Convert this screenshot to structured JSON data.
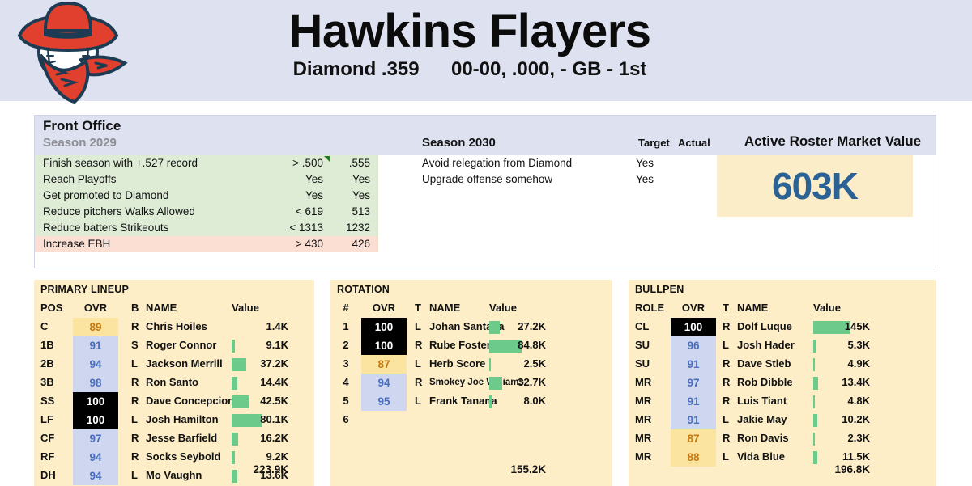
{
  "header": {
    "logo_icon": "cowboy-baseball-logo",
    "team_name": "Hawkins Flayers",
    "league": "Diamond .359",
    "record": "00-00, .000, - GB - 1st"
  },
  "front_office": {
    "title": "Front Office",
    "season_prev_label": "Season 2029",
    "season_cur_label": "Season 2030",
    "target_header": "Target",
    "actual_header": "Actual",
    "market_value_header": "Active Roster Market Value",
    "market_value": "603K",
    "prev_goals": [
      {
        "label": "Finish season with +.527 record",
        "target": "> .500",
        "actual": ".555",
        "status": "good",
        "marker": true
      },
      {
        "label": "Reach Playoffs",
        "target": "Yes",
        "actual": "Yes",
        "status": "good",
        "marker": false
      },
      {
        "label": "Get promoted to Diamond",
        "target": "Yes",
        "actual": "Yes",
        "status": "good",
        "marker": false
      },
      {
        "label": "Reduce pitchers Walks Allowed",
        "target": "< 619",
        "actual": "513",
        "status": "good",
        "marker": false
      },
      {
        "label": "Reduce batters Strikeouts",
        "target": "< 1313",
        "actual": "1232",
        "status": "good",
        "marker": false
      },
      {
        "label": "Increase EBH",
        "target": "> 430",
        "actual": "426",
        "status": "bad",
        "marker": false
      }
    ],
    "cur_goals": [
      {
        "label": "Avoid relegation from Diamond",
        "target": "Yes",
        "actual": ""
      },
      {
        "label": "Upgrade offense somehow",
        "target": "Yes",
        "actual": ""
      }
    ]
  },
  "lineup": {
    "title": "PRIMARY LINEUP",
    "columns": {
      "pos": "POS",
      "ovr": "OVR",
      "hand": "B",
      "name": "NAME",
      "value": "Value"
    },
    "total": "223.9K",
    "rows": [
      {
        "pos": "C",
        "ovr": "89",
        "tier": "gold",
        "hand": "R",
        "name": "Chris Hoiles",
        "value": "1.4K",
        "bar": 0
      },
      {
        "pos": "1B",
        "ovr": "91",
        "tier": "blue",
        "hand": "S",
        "name": "Roger Connor",
        "value": "9.1K",
        "bar": 4
      },
      {
        "pos": "2B",
        "ovr": "94",
        "tier": "blue",
        "hand": "L",
        "name": "Jackson Merrill",
        "value": "37.2K",
        "bar": 18
      },
      {
        "pos": "3B",
        "ovr": "98",
        "tier": "blue",
        "hand": "R",
        "name": "Ron Santo",
        "value": "14.4K",
        "bar": 7
      },
      {
        "pos": "SS",
        "ovr": "100",
        "tier": "black",
        "hand": "R",
        "name": "Dave Concepcion",
        "value": "42.5K",
        "bar": 21
      },
      {
        "pos": "LF",
        "ovr": "100",
        "tier": "black",
        "hand": "L",
        "name": "Josh Hamilton",
        "value": "80.1K",
        "bar": 38
      },
      {
        "pos": "CF",
        "ovr": "97",
        "tier": "blue",
        "hand": "R",
        "name": "Jesse Barfield",
        "value": "16.2K",
        "bar": 8
      },
      {
        "pos": "RF",
        "ovr": "94",
        "tier": "blue",
        "hand": "R",
        "name": "Socks Seybold",
        "value": "9.2K",
        "bar": 4
      },
      {
        "pos": "DH",
        "ovr": "94",
        "tier": "blue",
        "hand": "L",
        "name": "Mo Vaughn",
        "value": "13.6K",
        "bar": 7
      }
    ]
  },
  "rotation": {
    "title": "ROTATION",
    "columns": {
      "num": "#",
      "ovr": "OVR",
      "hand": "T",
      "name": "NAME",
      "value": "Value"
    },
    "total": "155.2K",
    "rows": [
      {
        "num": "1",
        "ovr": "100",
        "tier": "black",
        "hand": "L",
        "name": "Johan Santana",
        "value": "27.2K",
        "bar": 13,
        "small": false
      },
      {
        "num": "2",
        "ovr": "100",
        "tier": "black",
        "hand": "R",
        "name": "Rube Foster",
        "value": "84.8K",
        "bar": 40,
        "small": false
      },
      {
        "num": "3",
        "ovr": "87",
        "tier": "gold",
        "hand": "L",
        "name": "Herb Score",
        "value": "2.5K",
        "bar": 2,
        "small": false
      },
      {
        "num": "4",
        "ovr": "94",
        "tier": "blue",
        "hand": "R",
        "name": "Smokey Joe Williams",
        "value": "32.7K",
        "bar": 16,
        "small": true
      },
      {
        "num": "5",
        "ovr": "95",
        "tier": "blue",
        "hand": "L",
        "name": "Frank Tanana",
        "value": "8.0K",
        "bar": 3,
        "small": false
      },
      {
        "num": "6",
        "ovr": "",
        "tier": "empty",
        "hand": "",
        "name": "",
        "value": "",
        "bar": 0,
        "small": false
      }
    ]
  },
  "bullpen": {
    "title": "BULLPEN",
    "columns": {
      "role": "ROLE",
      "ovr": "OVR",
      "hand": "T",
      "name": "NAME",
      "value": "Value"
    },
    "total": "196.8K",
    "rows": [
      {
        "role": "CL",
        "ovr": "100",
        "tier": "black",
        "hand": "R",
        "name": "Dolf Luque",
        "value": "145K",
        "bar": 46
      },
      {
        "role": "SU",
        "ovr": "96",
        "tier": "blue",
        "hand": "L",
        "name": "Josh Hader",
        "value": "5.3K",
        "bar": 3
      },
      {
        "role": "SU",
        "ovr": "91",
        "tier": "blue",
        "hand": "R",
        "name": "Dave Stieb",
        "value": "4.9K",
        "bar": 2
      },
      {
        "role": "MR",
        "ovr": "97",
        "tier": "blue",
        "hand": "R",
        "name": "Rob Dibble",
        "value": "13.4K",
        "bar": 6
      },
      {
        "role": "MR",
        "ovr": "91",
        "tier": "blue",
        "hand": "R",
        "name": "Luis Tiant",
        "value": "4.8K",
        "bar": 2
      },
      {
        "role": "MR",
        "ovr": "91",
        "tier": "blue",
        "hand": "L",
        "name": "Jakie May",
        "value": "10.2K",
        "bar": 5
      },
      {
        "role": "MR",
        "ovr": "87",
        "tier": "gold",
        "hand": "R",
        "name": "Ron Davis",
        "value": "2.3K",
        "bar": 2
      },
      {
        "role": "MR",
        "ovr": "88",
        "tier": "gold",
        "hand": "L",
        "name": "Vida Blue",
        "value": "11.5K",
        "bar": 5
      }
    ]
  },
  "colors": {
    "header_bg": "#dde1f0",
    "panel_cream": "#fdeec8",
    "goal_good": "#deecd6",
    "goal_bad": "#fadfd2",
    "bar_green": "#6ccb8b",
    "ovr_blue_bg": "#ced7ef",
    "ovr_blue_fg": "#4a6fc0",
    "ovr_gold_bg": "#fbe3a0",
    "ovr_gold_fg": "#c47a12",
    "market_value_fg": "#2a6296",
    "logo_red": "#e1402e",
    "logo_navy": "#1d3c53"
  }
}
